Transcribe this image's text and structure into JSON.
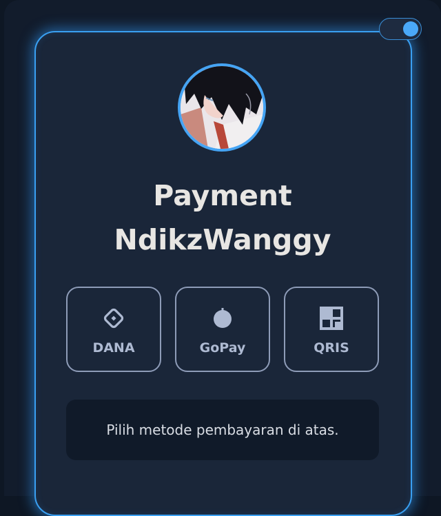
{
  "theme": {
    "accent": "#3aa0f2",
    "card_background": "#1a2639",
    "page_background": "#0e1724",
    "method_border": "#8e9cb8"
  },
  "theme_toggle": {
    "state": "on"
  },
  "profile": {
    "title_line1": "Payment",
    "title_line2": "NdikzWanggy"
  },
  "payment_methods": [
    {
      "label": "DANA",
      "icon": "diamond-icon"
    },
    {
      "label": "GoPay",
      "icon": "circle-icon"
    },
    {
      "label": "QRIS",
      "icon": "qr-grid-icon"
    }
  ],
  "message": {
    "text": "Pilih metode pembayaran di atas."
  }
}
